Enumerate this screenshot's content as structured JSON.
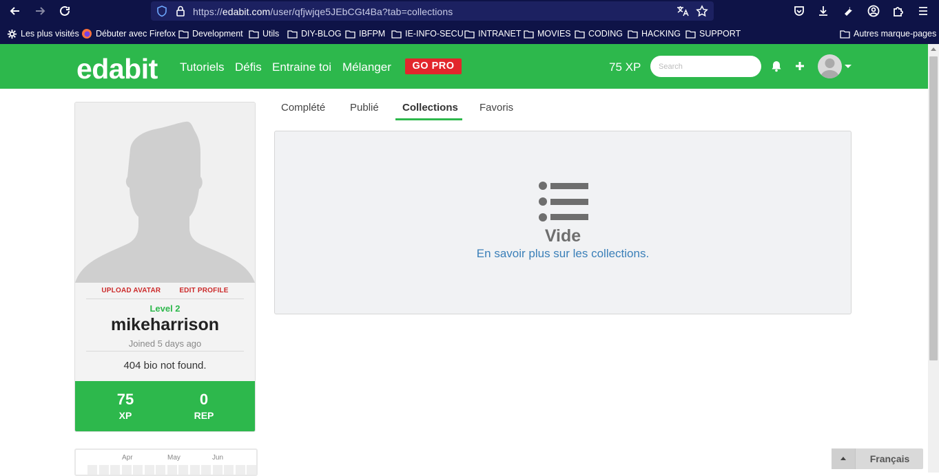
{
  "browser": {
    "url_prefix": "https://",
    "url_host": "edabit.com",
    "url_path": "/user/qfjwjqe5JEbCGt4Ba?tab=collections",
    "bookmarks": [
      {
        "label": "Les plus visités",
        "icon": "gear-icon"
      },
      {
        "label": "Débuter avec Firefox",
        "icon": "firefox-icon"
      },
      {
        "label": "Development",
        "icon": "folder-icon"
      },
      {
        "label": "Utils",
        "icon": "folder-icon"
      },
      {
        "label": "DIY-BLOG",
        "icon": "folder-icon"
      },
      {
        "label": "IBFPM",
        "icon": "folder-icon"
      },
      {
        "label": "IE-INFO-SECU",
        "icon": "folder-icon"
      },
      {
        "label": "INTRANET",
        "icon": "folder-icon"
      },
      {
        "label": "MOVIES",
        "icon": "folder-icon"
      },
      {
        "label": "CODING",
        "icon": "folder-icon"
      },
      {
        "label": "HACKING",
        "icon": "folder-icon"
      },
      {
        "label": "SUPPORT",
        "icon": "folder-icon"
      }
    ],
    "other_bookmarks": "Autres marque-pages"
  },
  "header": {
    "logo": "edabit",
    "nav": [
      "Tutoriels",
      "Défis",
      "Entraine toi",
      "Mélanger"
    ],
    "gopro": "GO PRO",
    "xp": "75 XP",
    "search_placeholder": "Search"
  },
  "profile": {
    "upload_avatar": "UPLOAD AVATAR",
    "edit_profile": "EDIT PROFILE",
    "level": "Level 2",
    "username": "mikeharrison",
    "joined": "Joined 5 days ago",
    "bio": "404 bio not found.",
    "xp_value": "75",
    "xp_label": "XP",
    "rep_value": "0",
    "rep_label": "REP"
  },
  "calendar": {
    "months": [
      "Apr",
      "May",
      "Jun"
    ]
  },
  "tabs": [
    "Complété",
    "Publié",
    "Collections",
    "Favoris"
  ],
  "active_tab": "Collections",
  "empty": {
    "title": "Vide",
    "link": "En savoir plus sur les collections."
  },
  "language": {
    "label": "Français"
  },
  "colors": {
    "brand_green": "#2db84c",
    "gopro_red": "#e2262c",
    "link_blue": "#3a7fb8",
    "chrome_navy": "#0e1347"
  }
}
